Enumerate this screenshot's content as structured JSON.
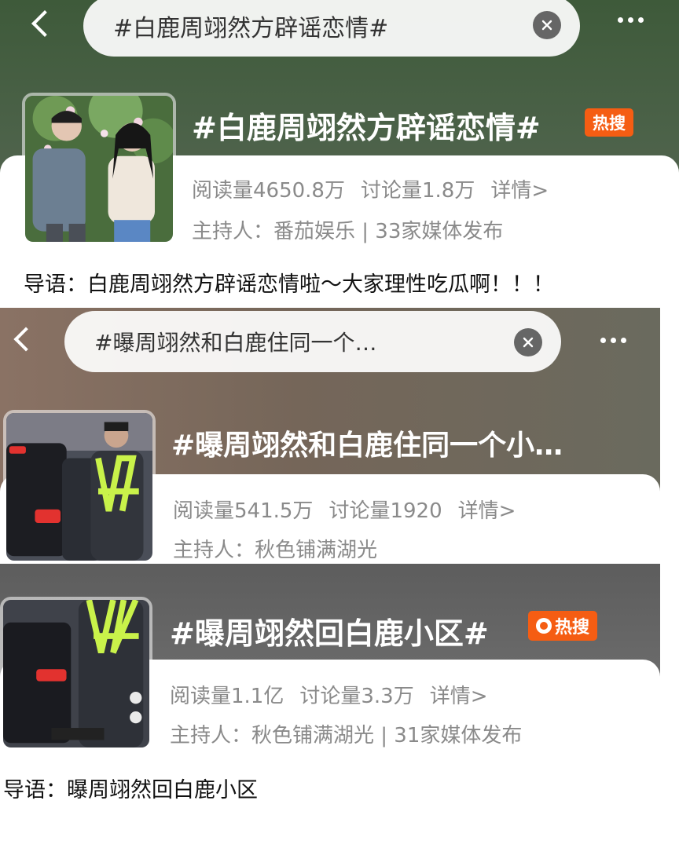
{
  "header1": {
    "search_text": "#白鹿周翊然方辟谣恋情#",
    "back_icon": "chevron-left-icon",
    "clear_icon": "close-circle-icon",
    "more_icon": "ellipsis-icon"
  },
  "topic1": {
    "title": "#白鹿周翊然方辟谣恋情#",
    "badge": "热搜",
    "reads": "阅读量4650.8万",
    "discussions": "讨论量1.8万",
    "details": "详情>",
    "host": "主持人：番茄娱乐 | 33家媒体发布",
    "lede": "导语：白鹿周翊然方辟谣恋情啦～大家理性吃瓜啊！！！"
  },
  "header2": {
    "search_text": "#曝周翊然和白鹿住同一个…",
    "back_icon": "chevron-left-icon",
    "clear_icon": "close-circle-icon",
    "more_icon": "ellipsis-icon"
  },
  "topic2": {
    "title": "#曝周翊然和白鹿住同一个小…",
    "reads": "阅读量541.5万",
    "discussions": "讨论量1920",
    "details": "详情>",
    "host": "主持人：秋色铺满湖光"
  },
  "topic3": {
    "title": "#曝周翊然回白鹿小区#",
    "badge": "热搜",
    "reads": "阅读量1.1亿",
    "discussions": "讨论量3.3万",
    "details": "详情>",
    "host": "主持人：秋色铺满湖光 | 31家媒体发布",
    "lede": "导语：曝周翊然回白鹿小区"
  },
  "colors": {
    "hot_badge": "#f55d13",
    "header_green": "#4e6b4c",
    "header_brown": "#7a6a62",
    "header_gray": "#676767",
    "meta_text": "#8a8a8a"
  }
}
